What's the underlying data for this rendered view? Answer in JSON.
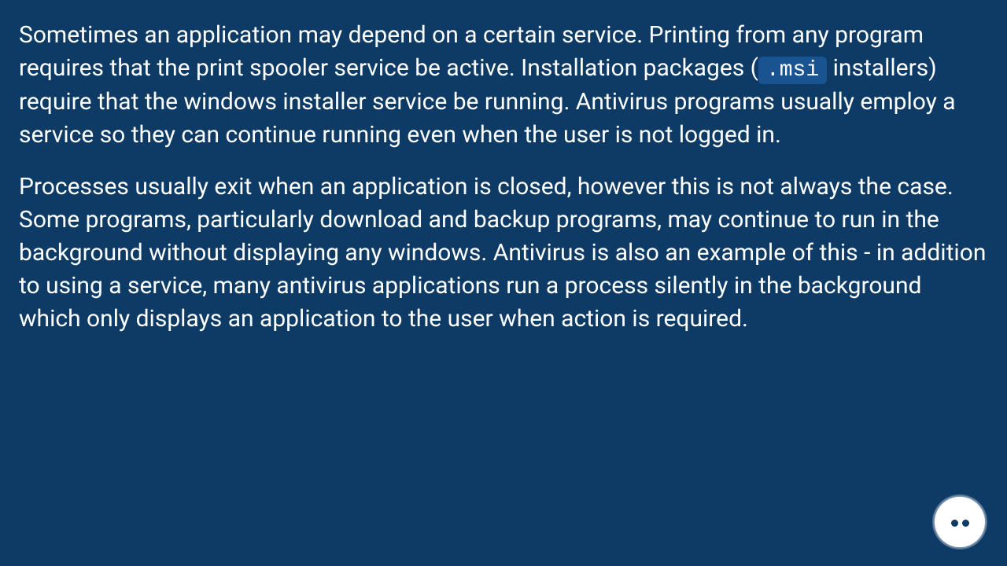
{
  "paragraphs": [
    {
      "before": "Sometimes an application may depend on a certain service. Printing from any program requires that the print spooler service be active. Installation packages (",
      "code": ".msi",
      "after": " installers) require that the windows installer service be running. Antivirus programs usually employ a service so they can continue running even when the user is not logged in."
    },
    {
      "text": "Processes usually exit when an application is closed, however this is not always the case. Some programs, particularly download and backup programs, may continue to run in the background without displaying any windows. Antivirus is also an example of this - in addition to using a service, many antivirus applications run a process silently in the background which only displays an application to the user when action is required."
    }
  ]
}
